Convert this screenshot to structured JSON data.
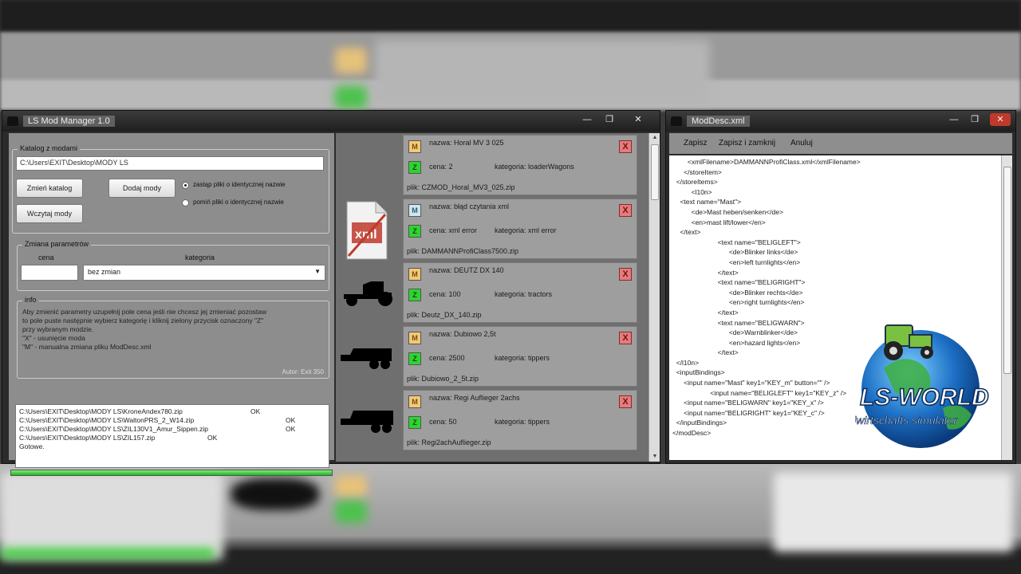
{
  "mod_manager": {
    "title": "LS Mod Manager 1.0",
    "window_controls": [
      "—",
      "❐",
      "✕"
    ],
    "catalog_group_label": "Katalog z modami",
    "catalog_path": "C:\\Users\\EXIT\\Desktop\\MODY LS",
    "change_folder_label": "Zmień katalog",
    "add_mods_label": "Dodaj mody",
    "read_mods_label": "Wczytaj mody",
    "radio_options": [
      {
        "label": "zastąp pliki o identycznej nazwie",
        "selected": true
      },
      {
        "label": "pomiń pliki o identycznej nazwie",
        "selected": false
      }
    ],
    "params_group_label": "Zmiana parametrów",
    "price_label": "cena",
    "category_label": "kategoria",
    "price_value": "",
    "category_value": "bez zmian",
    "info_group_label": "info",
    "info_lines": [
      "Aby zmienić parametry uzupełnij pole cena jeśli nie chcesz jej zmieniać pozostaw",
      "to pole puste następnie wybierz kategorię i kliknij zielony przycisk oznaczony \"Z\"",
      "przy wybranym modzie.",
      "\"X\" - usunięcie moda",
      "\"M\" - manualna zmiana pliku ModDesc.xml"
    ],
    "author": "Autor: Exit 350",
    "log": [
      {
        "path": "C:\\Users\\EXIT\\Desktop\\MODY LS\\KroneAndex780.zip",
        "status": "OK"
      },
      {
        "path": "C:\\Users\\EXIT\\Desktop\\MODY LS\\WaltonPRS_2_W14.zip",
        "status": "OK"
      },
      {
        "path": "C:\\Users\\EXIT\\Desktop\\MODY LS\\ZIL130V1_Amur_Sippen.zip",
        "status": "OK"
      },
      {
        "path": "C:\\Users\\EXIT\\Desktop\\MODY LS\\ZIL157.zip",
        "status": "OK"
      }
    ],
    "log_done": "Gotowe.",
    "progress": 1.0,
    "mods": [
      {
        "name": "nazwa: Horal MV 3 025",
        "price": "cena: 2",
        "category": "kategoria: loaderWagons",
        "file": "plik: CZMOD_Horal_MV3_025.zip",
        "icon": "trailer-silhouette",
        "m_style": "normal"
      },
      {
        "name": "nazwa: błąd czytania xml",
        "price": "cena: xml error",
        "category": "kategoria: xml error",
        "file": "plik: DAMMANNProfiClass7500.zip",
        "icon": "xml-error-icon",
        "m_style": "blue"
      },
      {
        "name": "nazwa: DEUTZ DX 140",
        "price": "cena: 100",
        "category": "kategoria: tractors",
        "file": "plik: Deutz_DX_140.zip",
        "icon": "tractor-silhouette",
        "m_style": "normal"
      },
      {
        "name": "nazwa: Dubiowo 2,5t",
        "price": "cena: 2500",
        "category": "kategoria: tippers",
        "file": "plik: Dubiowo_2_5t.zip",
        "icon": "trailer-silhouette",
        "m_style": "normal"
      },
      {
        "name": "nazwa: Regi Auflieger 2achs",
        "price": "cena: 50",
        "category": "kategoria: tippers",
        "file": "plik: Regi2achAuflieger.zip",
        "icon": "trailer-silhouette",
        "m_style": "normal"
      }
    ],
    "badges": {
      "m": "M",
      "z": "Z",
      "x": "X"
    }
  },
  "mod_desc": {
    "title": "ModDesc.xml",
    "window_controls": [
      "—",
      "❐",
      "✕"
    ],
    "menu": [
      "Zapisz",
      "Zapisz i zamknij",
      "Anuluj"
    ],
    "code_lines": [
      "        <xmlFilename>DAMMANNProfiClass.xml</xmlFilename>",
      "      </storeItem>",
      "  </storeItems>",
      "          <l10n>",
      "    <text name=\"Mast\">",
      "          <de>Mast heben/senken</de>",
      "          <en>mast lift/lower</en>",
      "    </text>",
      "                        <text name=\"BELIGLEFT\">",
      "                              <de>Blinker links</de>",
      "                              <en>left turnlights</en>",
      "                        </text>",
      "                        <text name=\"BELIGRIGHT\">",
      "                              <de>Blinker rechts</de>",
      "                              <en>right turnlights</en>",
      "                        </text>",
      "                        <text name=\"BELIGWARN\">",
      "                              <de>Warnblinker</de>",
      "                              <en>hazard lights</en>",
      "                        </text>",
      "  </l10n>",
      "  <inputBindings>",
      "      <input name=\"Mast\" key1=\"KEY_m\" button=\"\" />",
      "                    <input name=\"BELIGLEFT\" key1=\"KEY_z\" />",
      "      <input name=\"BELIGWARN\" key1=\"KEY_x\" />",
      "      <input name=\"BELIGRIGHT\" key1=\"KEY_c\" />",
      "  </inputBindings>",
      "",
      "</modDesc>"
    ]
  },
  "watermark": {
    "brand": "LS-WORLD",
    "subtitle": "Landwirtschafts simulator"
  },
  "colors": {
    "progress": "#22b222",
    "badge_z": "#2fd32f",
    "badge_m": "#f3c878",
    "delete": "#e17d7d"
  }
}
